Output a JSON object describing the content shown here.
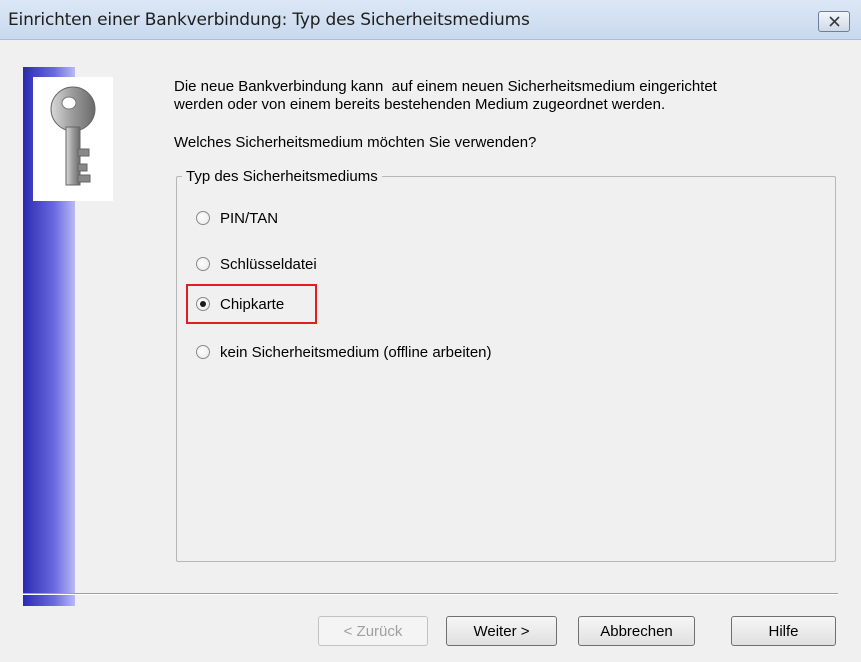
{
  "window": {
    "title": "Einrichten einer Bankverbindung: Typ des Sicherheitsmediums",
    "close_icon": "close-icon"
  },
  "content": {
    "intro_line1": "Die neue Bankverbindung kann  auf einem neuen Sicherheitsmedium eingerichtet",
    "intro_line2": "werden oder von einem bereits bestehenden Medium zugeordnet werden.",
    "question": "Welches Sicherheitsmedium möchten Sie verwenden?",
    "group_label": "Typ des Sicherheitsmediums",
    "options": [
      {
        "label": "PIN/TAN",
        "checked": false
      },
      {
        "label": "Schlüsseldatei",
        "checked": false
      },
      {
        "label": "Chipkarte",
        "checked": true
      },
      {
        "label": "kein Sicherheitsmedium (offline arbeiten)",
        "checked": false
      }
    ],
    "highlight_color": "#e02020"
  },
  "buttons": {
    "back": "< Zurück",
    "next": "Weiter >",
    "cancel": "Abbrechen",
    "help": "Hilfe"
  },
  "icons": {
    "key": "key-icon"
  }
}
